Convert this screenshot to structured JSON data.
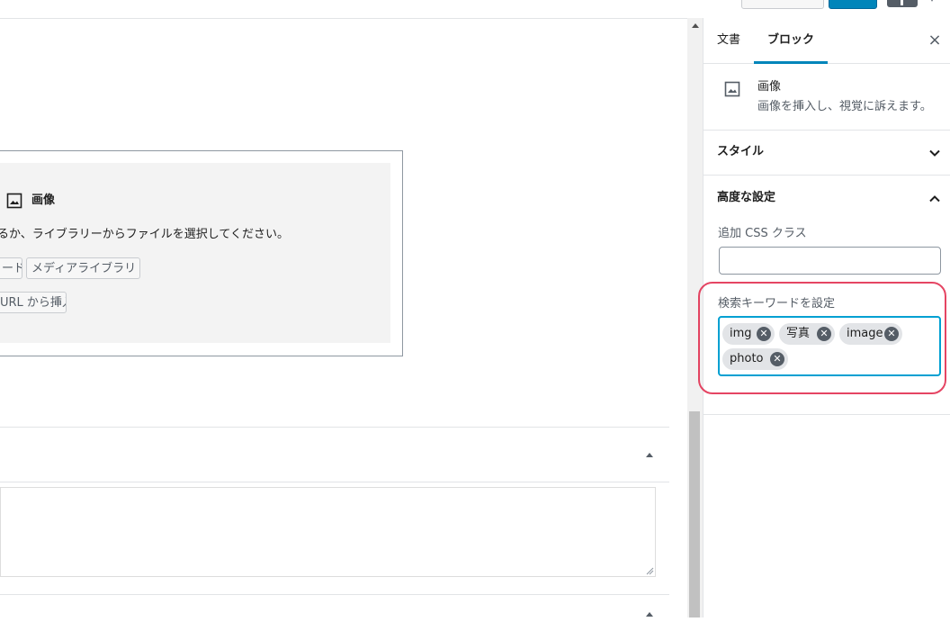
{
  "placeholder": {
    "title": "画像",
    "instructions": "るか、ライブラリーからファイルを選択してください。",
    "upload_label": "ード",
    "media_label": "メディアライブラリ",
    "url_label": "URL から挿入"
  },
  "sidebar": {
    "tabs": [
      {
        "label": "文書"
      },
      {
        "label": "ブロック"
      }
    ],
    "close_label": "×",
    "block_card": {
      "title": "画像",
      "description": "画像を挿入し、視覚に訴えます。"
    },
    "style_panel": {
      "title": "スタイル"
    },
    "advanced_panel": {
      "title": "高度な設定",
      "css_label": "追加 CSS クラス",
      "css_value": "",
      "keywords_label": "検索キーワードを設定",
      "keywords": [
        "img",
        "写真",
        "image",
        "photo"
      ]
    }
  },
  "colors": {
    "accent": "#0085ba",
    "focus": "#00a0d2",
    "highlight": "#e02448"
  }
}
